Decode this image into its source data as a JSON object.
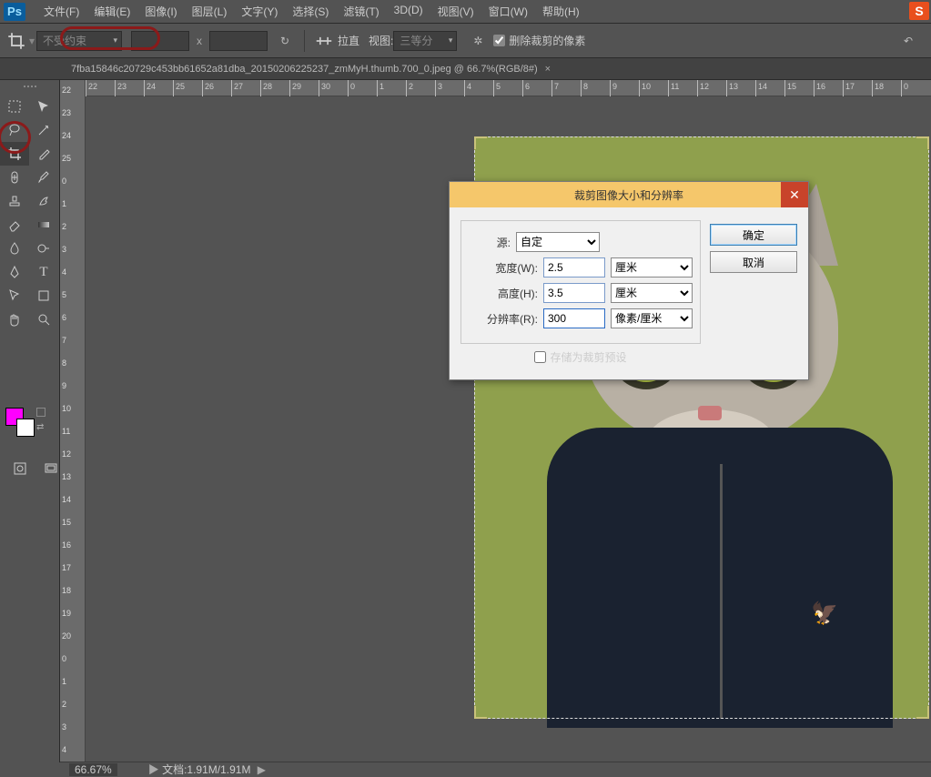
{
  "menu": {
    "items": [
      "文件(F)",
      "编辑(E)",
      "图像(I)",
      "图层(L)",
      "文字(Y)",
      "选择(S)",
      "滤镜(T)",
      "3D(D)",
      "视图(V)",
      "窗口(W)",
      "帮助(H)"
    ]
  },
  "options": {
    "preset": "不受约束",
    "x_label": "x",
    "straighten": "拉直",
    "view_label": "视图:",
    "view_value": "三等分",
    "delete_label": "删除裁剪的像素",
    "delete_checked": true
  },
  "tab": {
    "title": "7fba15846c20729c453bb61652a81dba_20150206225237_zmMyH.thumb.700_0.jpeg @ 66.7%(RGB/8#)"
  },
  "dialog": {
    "title": "裁剪图像大小和分辨率",
    "source_label": "源:",
    "source_value": "自定",
    "width_label": "宽度(W):",
    "width_value": "2.5",
    "width_unit": "厘米",
    "height_label": "高度(H):",
    "height_value": "3.5",
    "height_unit": "厘米",
    "res_label": "分辨率(R):",
    "res_value": "300",
    "res_unit": "像素/厘米",
    "save_preset": "存储为裁剪预设",
    "ok": "确定",
    "cancel": "取消"
  },
  "status": {
    "zoom": "66.67%",
    "doc": "文档:1.91M/1.91M"
  },
  "hruler_ticks": [
    22,
    23,
    24,
    25,
    26,
    27,
    28,
    29,
    30,
    0,
    1,
    2,
    3,
    4,
    5,
    6,
    7,
    8,
    9,
    10,
    11,
    12,
    13,
    14,
    15,
    16,
    17,
    18,
    0
  ],
  "vruler_ticks": [
    22,
    23,
    24,
    25,
    0,
    1,
    2,
    3,
    4,
    5,
    6,
    7,
    8,
    9,
    10,
    11,
    12,
    13,
    14,
    15,
    16,
    17,
    18,
    19,
    20,
    0,
    1,
    2,
    3,
    4
  ]
}
